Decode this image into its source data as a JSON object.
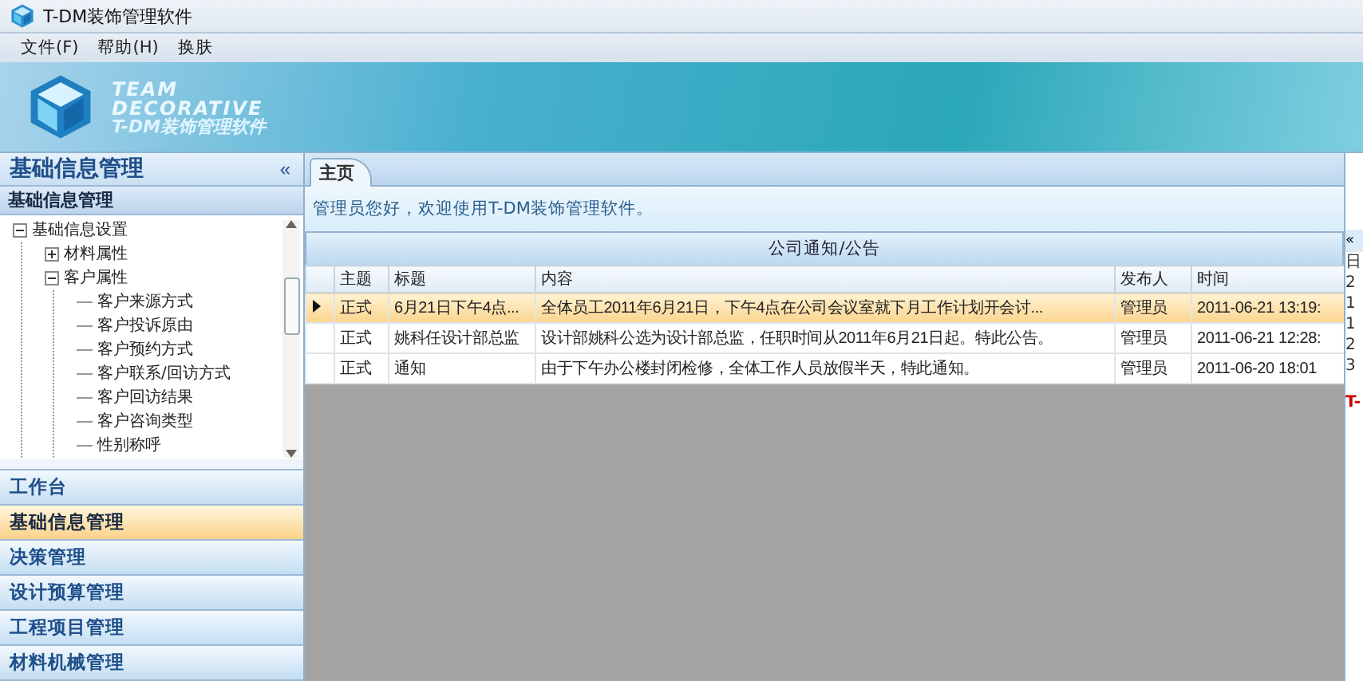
{
  "window": {
    "title": "T-DM装饰管理软件"
  },
  "menu": [
    {
      "label": "文件(F)"
    },
    {
      "label": "帮助(H)"
    },
    {
      "label": "换肤"
    }
  ],
  "banner": {
    "brand_line_1": "TEAM",
    "brand_line_2": "DECORATIVE",
    "product_name": "T-DM装饰管理软件"
  },
  "sidebar": {
    "title": "基础信息管理",
    "collapse_button": "«",
    "section_title": "基础信息管理",
    "tree": [
      {
        "label": "基础信息设置",
        "expanded": true,
        "children": [
          {
            "label": "材料属性",
            "expanded": false
          },
          {
            "label": "客户属性",
            "expanded": true,
            "children": [
              {
                "label": "客户来源方式"
              },
              {
                "label": "客户投诉原由"
              },
              {
                "label": "客户预约方式"
              },
              {
                "label": "客户联系/回访方式"
              },
              {
                "label": "客户回访结果"
              },
              {
                "label": "客户咨询类型"
              },
              {
                "label": "性别称呼"
              }
            ]
          }
        ]
      }
    ],
    "nav": [
      {
        "label": "工作台",
        "selected": false
      },
      {
        "label": "基础信息管理",
        "selected": true
      },
      {
        "label": "决策管理",
        "selected": false
      },
      {
        "label": "设计预算管理",
        "selected": false
      },
      {
        "label": "工程项目管理",
        "selected": false
      },
      {
        "label": "材料机械管理",
        "selected": false
      }
    ]
  },
  "tabs": [
    {
      "label": "主页",
      "selected": true
    }
  ],
  "welcome": "管理员您好，欢迎使用T-DM装饰管理软件。",
  "notices": {
    "title": "公司通知/公告",
    "columns": [
      "主题",
      "标题",
      "内容",
      "发布人",
      "时间"
    ],
    "rows": [
      {
        "selected": true,
        "cells": [
          "正式",
          "6月21日下午4点...",
          "全体员工2011年6月21日，下午4点在公司会议室就下月工作计划开会讨...",
          "管理员",
          "2011-06-21 13:19:"
        ]
      },
      {
        "selected": false,
        "cells": [
          "正式",
          "姚科任设计部总监",
          "设计部姚科公选为设计部总监，任职时间从2011年6月21日起。特此公告。",
          "管理员",
          "2011-06-21 12:28:"
        ]
      },
      {
        "selected": false,
        "cells": [
          "正式",
          "通知",
          "由于下午办公楼封闭检修，全体工作人员放假半天，特此通知。",
          "管理员",
          "2011-06-20 18:01"
        ]
      }
    ]
  },
  "right_panel": {
    "collapse_button": "«",
    "header": "日",
    "items": [
      "2",
      "1",
      "1",
      "2",
      "3"
    ],
    "footer": "T-"
  }
}
